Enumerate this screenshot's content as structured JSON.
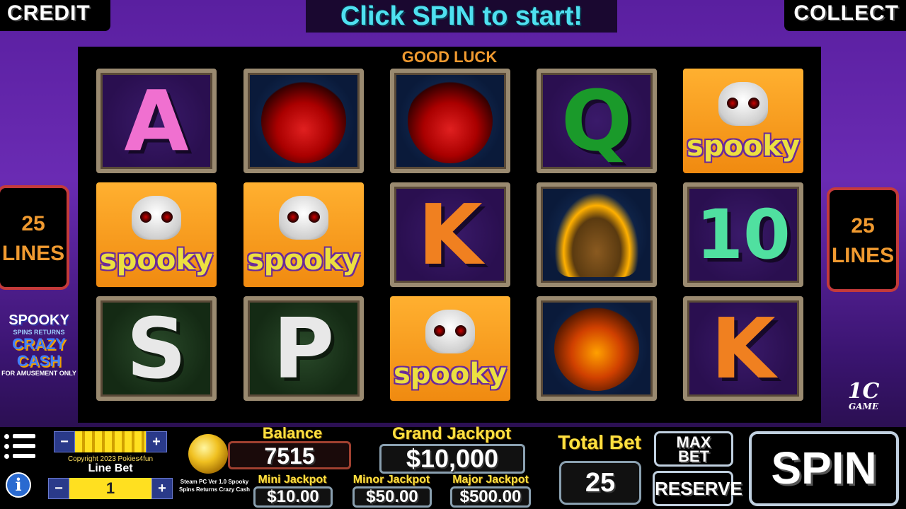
{
  "header": {
    "credit_label": "CREDIT",
    "collect_label": "COLLECT",
    "banner": "Click SPIN to start!"
  },
  "reels": {
    "status": "GOOD LUCK",
    "grid": [
      [
        "A",
        "potion",
        "potion",
        "Q",
        "spooky"
      ],
      [
        "spooky",
        "spooky",
        "K",
        "hat",
        "10"
      ],
      [
        "S",
        "P",
        "spooky",
        "pumpkin",
        "K"
      ]
    ],
    "spooky_text": "spooky"
  },
  "lines": {
    "left_count": "25",
    "left_label": "LINES",
    "right_count": "25",
    "right_label": "LINES"
  },
  "logo": {
    "title": "SPOOKY",
    "subtitle": "SPINS RETURNS",
    "crazy": "CRAZY",
    "cash": "CASH",
    "note": "FOR AMUSEMENT ONLY"
  },
  "brand": {
    "big": "1C",
    "small": "GAME"
  },
  "panel": {
    "copyright": "Copyright 2023 Pokies4fun",
    "line_bet_label": "Line Bet",
    "line_bet_value": "1",
    "game_names": "Steam PC Ver 1.0 Spooky Spins Returns Crazy Cash",
    "balance_label": "Balance",
    "balance_value": "7515",
    "grand_label": "Grand Jackpot",
    "grand_value": "$10,000",
    "mini_label": "Mini Jackpot",
    "mini_value": "$10.00",
    "minor_label": "Minor Jackpot",
    "minor_value": "$50.00",
    "major_label": "Major Jackpot",
    "major_value": "$500.00",
    "total_bet_label": "Total Bet",
    "total_bet_value": "25",
    "max_bet_label_1": "MAX",
    "max_bet_label_2": "BET",
    "reserve_label": "RESERVE",
    "spin_label": "SPIN",
    "minus": "−",
    "plus": "+",
    "info": "i"
  },
  "colors": {
    "banner_text": "#4fe0f0",
    "good_luck": "#f09a30",
    "lines_border": "#c43a3a",
    "gold": "#ffe040"
  }
}
